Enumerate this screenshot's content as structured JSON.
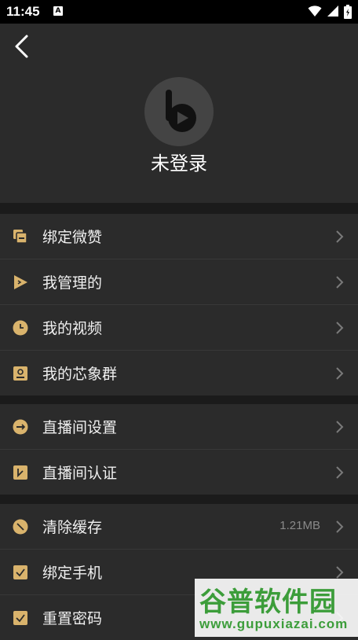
{
  "status_bar": {
    "time": "11:45",
    "app_indicator": "A",
    "icons": [
      "wifi-icon",
      "signal-icon",
      "battery-icon"
    ]
  },
  "header": {
    "back_icon": "back-arrow-icon",
    "avatar_icon": "app-logo-icon",
    "login_status": "未登录"
  },
  "groups": [
    {
      "items": [
        {
          "label": "绑定微赞",
          "icon": "bind-icon"
        },
        {
          "label": "我管理的",
          "icon": "play-icon"
        },
        {
          "label": "我的视频",
          "icon": "clock-icon"
        },
        {
          "label": "我的芯象群",
          "icon": "group-icon"
        }
      ]
    },
    {
      "items": [
        {
          "label": "直播间设置",
          "icon": "settings-icon"
        },
        {
          "label": "直播间认证",
          "icon": "certify-icon"
        }
      ]
    },
    {
      "items": [
        {
          "label": "清除缓存",
          "icon": "clear-cache-icon",
          "value": "1.21MB"
        },
        {
          "label": "绑定手机",
          "icon": "phone-icon"
        },
        {
          "label": "重置密码",
          "icon": "password-icon"
        }
      ]
    }
  ],
  "watermark": {
    "text": "谷普软件园",
    "url": "www.gupuxiazai.com"
  },
  "colors": {
    "accent": "#d9b36c",
    "panel": "#2b2b2b",
    "background": "#1b1b1b"
  }
}
